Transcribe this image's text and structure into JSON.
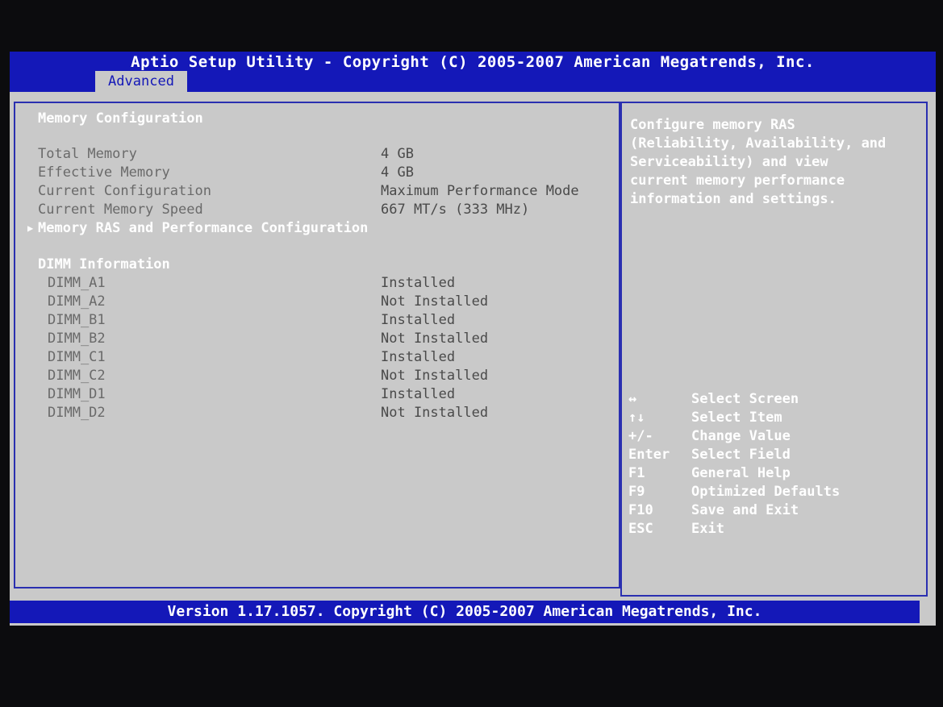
{
  "header": {
    "title": "Aptio Setup Utility - Copyright (C) 2005-2007 American Megatrends, Inc.",
    "active_tab": "Advanced"
  },
  "main": {
    "section_title": "Memory Configuration",
    "summary": [
      {
        "label": "Total Memory",
        "value": "4 GB"
      },
      {
        "label": "Effective Memory",
        "value": "4 GB"
      },
      {
        "label": "Current Configuration",
        "value": "Maximum Performance Mode"
      },
      {
        "label": "Current Memory Speed",
        "value": "667 MT/s (333 MHz)"
      }
    ],
    "submenu": {
      "arrow": "▶",
      "label": "Memory RAS and Performance Configuration"
    },
    "dimm_title": "DIMM Information",
    "dimms": [
      {
        "label": "DIMM_A1",
        "value": "Installed"
      },
      {
        "label": "DIMM_A2",
        "value": "Not Installed"
      },
      {
        "label": "DIMM_B1",
        "value": "Installed"
      },
      {
        "label": "DIMM_B2",
        "value": "Not Installed"
      },
      {
        "label": "DIMM_C1",
        "value": "Installed"
      },
      {
        "label": "DIMM_C2",
        "value": "Not Installed"
      },
      {
        "label": "DIMM_D1",
        "value": "Installed"
      },
      {
        "label": "DIMM_D2",
        "value": "Not Installed"
      }
    ]
  },
  "help": {
    "description_lines": [
      "Configure memory RAS",
      "(Reliability, Availability, and",
      "Serviceability) and view",
      "current memory performance",
      "information and settings."
    ],
    "keys": [
      {
        "key": "↔",
        "desc": "Select Screen"
      },
      {
        "key": "↑↓",
        "desc": "Select Item"
      },
      {
        "key": "+/-",
        "desc": "Change Value"
      },
      {
        "key": "Enter",
        "desc": "Select Field"
      },
      {
        "key": "F1",
        "desc": "General Help"
      },
      {
        "key": "F9",
        "desc": "Optimized Defaults"
      },
      {
        "key": "F10",
        "desc": "Save and Exit"
      },
      {
        "key": "ESC",
        "desc": "Exit"
      }
    ]
  },
  "footer": {
    "text": "Version 1.17.1057. Copyright (C) 2005-2007 American Megatrends, Inc."
  },
  "colors": {
    "title_bar": "#1418b8",
    "panel_bg": "#c9c9c9",
    "border": "#2a2fb0",
    "highlight_text": "#ffffff"
  }
}
